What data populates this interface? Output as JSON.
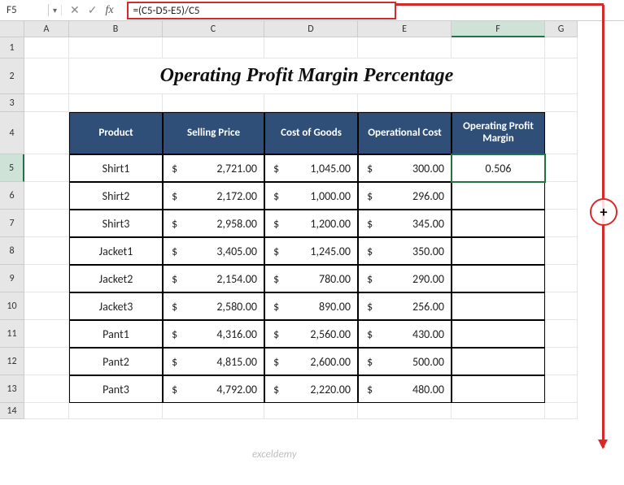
{
  "name_box": "F5",
  "formula": "=(C5-D5-E5)/C5",
  "columns": [
    "A",
    "B",
    "C",
    "D",
    "E",
    "F",
    "G"
  ],
  "selected_col": "F",
  "selected_row": 5,
  "row_count": 14,
  "title": "Operating Profit Margin Percentage",
  "headers": {
    "product": "Product",
    "selling": "Selling Price",
    "cost": "Cost of Goods",
    "operational": "Operational Cost",
    "margin": "Operating Profit Margin"
  },
  "currency": "$",
  "rows": [
    {
      "product": "Shirt1",
      "selling": "2,721.00",
      "cost": "1,045.00",
      "oper": "300.00",
      "margin": "0.506"
    },
    {
      "product": "Shirt2",
      "selling": "2,172.00",
      "cost": "1,000.00",
      "oper": "296.00",
      "margin": ""
    },
    {
      "product": "Shirt3",
      "selling": "2,958.00",
      "cost": "1,200.00",
      "oper": "345.00",
      "margin": ""
    },
    {
      "product": "Jacket1",
      "selling": "3,405.00",
      "cost": "1,245.00",
      "oper": "350.00",
      "margin": ""
    },
    {
      "product": "Jacket2",
      "selling": "2,154.00",
      "cost": "780.00",
      "oper": "290.00",
      "margin": ""
    },
    {
      "product": "Jacket3",
      "selling": "2,580.00",
      "cost": "890.00",
      "oper": "256.00",
      "margin": ""
    },
    {
      "product": "Pant1",
      "selling": "4,316.00",
      "cost": "2,560.00",
      "oper": "430.00",
      "margin": ""
    },
    {
      "product": "Pant2",
      "selling": "4,815.00",
      "cost": "2,600.00",
      "oper": "500.00",
      "margin": ""
    },
    {
      "product": "Pant3",
      "selling": "4,792.00",
      "cost": "2,220.00",
      "oper": "480.00",
      "margin": ""
    }
  ],
  "fill_handle": "+",
  "watermark": "exceldemy"
}
